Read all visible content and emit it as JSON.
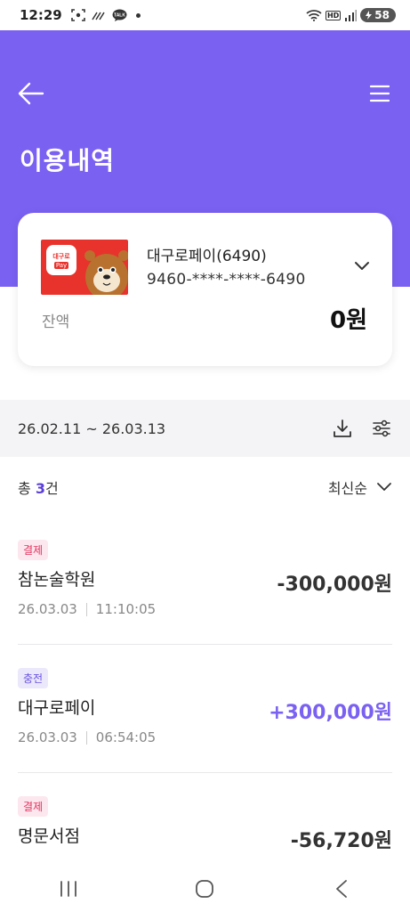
{
  "status_bar": {
    "time": "12:29",
    "battery": "58",
    "hd_label": "HD",
    "talk_label": "TALK",
    "icons": [
      "screenshot-icon",
      "signal-dots-icon",
      "talk-icon",
      "notification-dot-icon",
      "wifi-icon",
      "hd-icon",
      "signal-icon",
      "battery-icon"
    ]
  },
  "header": {
    "title": "이용내역",
    "background_color": "#7b61f2"
  },
  "card": {
    "name": "대구로페이(6490)",
    "number": "9460-****-****-6490",
    "balance_label": "잔액",
    "balance_value": "0원",
    "logo_text": "대구로",
    "logo_sub": "Pay",
    "image_color": "#e8322c"
  },
  "filter": {
    "date_range": "26.02.11 ~ 26.03.13",
    "icons": [
      "download-icon",
      "filter-settings-icon"
    ]
  },
  "summary": {
    "total_prefix": "총 ",
    "total_count": "3",
    "total_suffix": "건",
    "sort_label": "최신순"
  },
  "transactions": [
    {
      "type_label": "결제",
      "type": "pay",
      "name": "참논술학원",
      "date": "26.03.03",
      "time": "11:10:05",
      "amount": "-300,000원"
    },
    {
      "type_label": "충전",
      "type": "charge",
      "name": "대구로페이",
      "date": "26.03.03",
      "time": "06:54:05",
      "amount": "+300,000원"
    },
    {
      "type_label": "결제",
      "type": "pay",
      "name": "명문서점",
      "date": "",
      "time": "",
      "amount": "-56,720원"
    }
  ],
  "navbar": {
    "icons": [
      "recent-apps-icon",
      "home-icon",
      "back-nav-icon"
    ]
  }
}
